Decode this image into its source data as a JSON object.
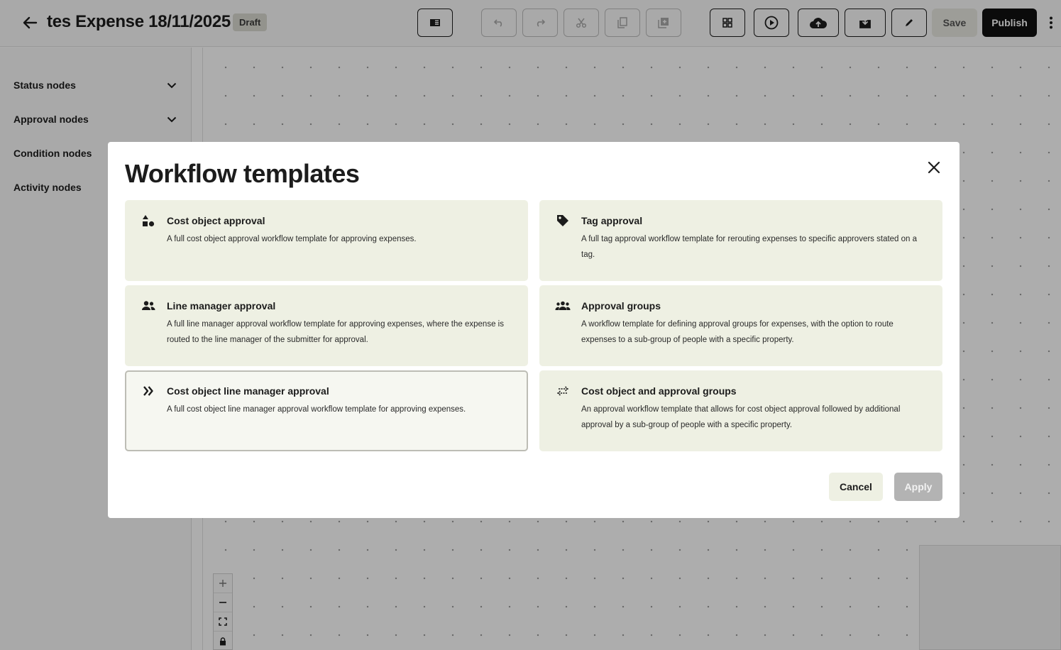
{
  "header": {
    "title": "tes Expense 18/11/2025",
    "status_badge": "Draft",
    "save_label": "Save",
    "publish_label": "Publish"
  },
  "sidebar": {
    "items": [
      {
        "label": "Status nodes",
        "has_chevron": true
      },
      {
        "label": "Approval nodes",
        "has_chevron": true
      },
      {
        "label": "Condition nodes",
        "has_chevron": false
      },
      {
        "label": "Activity nodes",
        "has_chevron": false
      }
    ]
  },
  "modal": {
    "title": "Workflow templates",
    "templates": [
      {
        "icon": "shapes-icon",
        "title": "Cost object approval",
        "description": "A full cost object approval workflow template for approving expenses.",
        "selected": false
      },
      {
        "icon": "tag-icon",
        "title": "Tag approval",
        "description": "A full tag approval workflow template for rerouting expenses to specific approvers stated on a tag.",
        "selected": false
      },
      {
        "icon": "people-icon",
        "title": "Line manager approval",
        "description": "A full line manager approval workflow template for approving expenses, where the expense is routed to the line manager of the submitter for approval.",
        "selected": false
      },
      {
        "icon": "groups-icon",
        "title": "Approval groups",
        "description": "A workflow template for defining approval groups for expenses, with the option to route expenses to a sub-group of people with a specific property.",
        "selected": false
      },
      {
        "icon": "double-chevron-right-icon",
        "title": "Cost object line manager approval",
        "description": "A full cost object line manager approval workflow template for approving expenses.",
        "selected": true
      },
      {
        "icon": "swap-arrows-icon",
        "title": "Cost object and approval groups",
        "description": "An approval workflow template that allows for cost object approval followed by additional approval by a sub-group of people with a specific property.",
        "selected": false
      }
    ],
    "cancel_label": "Cancel",
    "apply_label": "Apply"
  },
  "colors": {
    "card_bg": "#eef0e3",
    "selected_card_border": "#bdbdb5",
    "publish_bg": "#111111",
    "apply_disabled_bg": "#b3b3b3"
  }
}
